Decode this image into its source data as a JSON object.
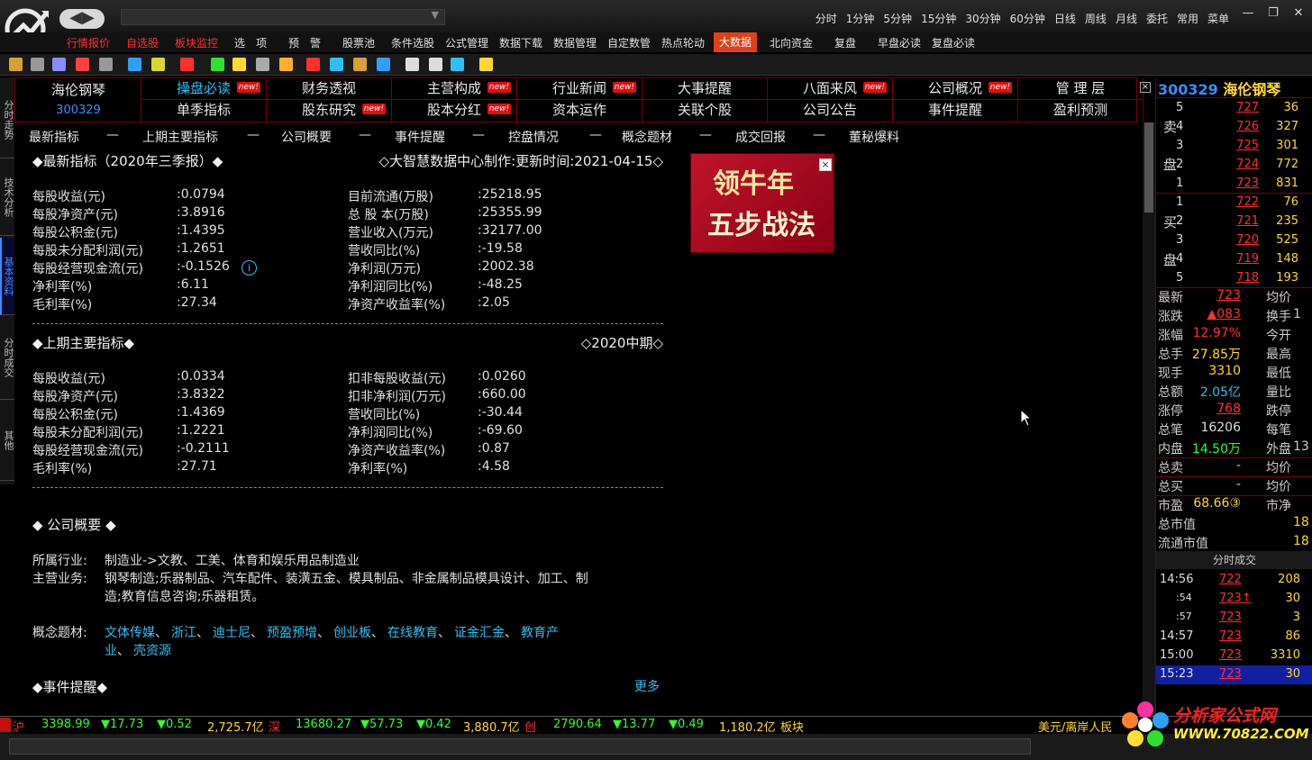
{
  "titlebar": {
    "back_label": "◀▶",
    "periods": [
      "分时",
      "1分钟",
      "5分钟",
      "15分钟",
      "30分钟",
      "60分钟",
      "日线",
      "周线",
      "月线",
      "委托",
      "常用",
      "菜单"
    ]
  },
  "menu": [
    {
      "label": "行情报价",
      "style": "red"
    },
    {
      "label": "自选股",
      "style": "red"
    },
    {
      "label": "板块监控",
      "style": "red"
    },
    {
      "label": "选　项",
      "style": ""
    },
    {
      "label": "预　警",
      "style": ""
    },
    {
      "label": "股票池",
      "style": ""
    },
    {
      "label": "条件选股",
      "style": ""
    },
    {
      "label": "公式管理",
      "style": ""
    },
    {
      "label": "数据下载",
      "style": ""
    },
    {
      "label": "数据管理",
      "style": ""
    },
    {
      "label": "自定数管",
      "style": ""
    },
    {
      "label": "热点轮动",
      "style": ""
    },
    {
      "label": "大数据",
      "style": "active"
    },
    {
      "label": "北向资金",
      "style": ""
    },
    {
      "label": "复盘",
      "style": ""
    },
    {
      "label": "早盘必读",
      "style": ""
    },
    {
      "label": "复盘必读",
      "style": ""
    }
  ],
  "left_tabs": [
    "分时走势",
    "技术分析",
    "基本资料",
    "分时成交",
    "其他"
  ],
  "stock": {
    "name": "海伦钢琴",
    "code": "300329"
  },
  "function_grid": {
    "row1": [
      {
        "label": "操盘必读",
        "new": true,
        "color": "#30c0f0"
      },
      {
        "label": "财务透视",
        "new": false
      },
      {
        "label": "主营构成",
        "new": true
      },
      {
        "label": "行业新闻",
        "new": true
      },
      {
        "label": "大事提醒",
        "new": false
      },
      {
        "label": "八面来风",
        "new": true
      },
      {
        "label": "公司概况",
        "new": true
      },
      {
        "label": "管 理 层",
        "new": false
      }
    ],
    "row2": [
      {
        "label": "单季指标",
        "new": false
      },
      {
        "label": "股东研究",
        "new": true
      },
      {
        "label": "股本分红",
        "new": true
      },
      {
        "label": "资本运作",
        "new": false
      },
      {
        "label": "关联个股",
        "new": false
      },
      {
        "label": "公司公告",
        "new": false
      },
      {
        "label": "事件提醒",
        "new": false
      },
      {
        "label": "盈利预测",
        "new": false
      }
    ],
    "new_badge": "new!",
    "close": "×"
  },
  "subtabs": [
    "最新指标",
    "—",
    "上期主要指标",
    "—",
    "公司概要",
    "—",
    "事件提醒",
    "—",
    "控盘情况",
    "—",
    "概念题材",
    "—",
    "成交回报",
    "—",
    "董秘爆料"
  ],
  "section1": {
    "title": "◆最新指标（2020年三季报）◆",
    "source": "◇大智慧数据中心制作:更新时间:2021-04-15◇",
    "left": [
      {
        "k": "每股收益(元)",
        "v": ":0.0794"
      },
      {
        "k": "每股净资产(元)",
        "v": ":3.8916"
      },
      {
        "k": "每股公积金(元)",
        "v": ":1.4395"
      },
      {
        "k": "每股未分配利润(元)",
        "v": ":1.2651"
      },
      {
        "k": "每股经营现金流(元)",
        "v": ":-0.1526"
      },
      {
        "k": "净利率(%)",
        "v": ":6.11"
      },
      {
        "k": "毛利率(%)",
        "v": ":27.34"
      }
    ],
    "right": [
      {
        "k": "目前流通(万股)",
        "v": ":25218.95"
      },
      {
        "k": "总 股 本(万股)",
        "v": ":25355.99"
      },
      {
        "k": "营业收入(万元)",
        "v": ":32177.00"
      },
      {
        "k": "营收同比(%)",
        "v": ":-19.58"
      },
      {
        "k": "净利润(万元)",
        "v": ":2002.38"
      },
      {
        "k": "净利润同比(%)",
        "v": ":-48.25"
      },
      {
        "k": "净资产收益率(%)",
        "v": ":2.05"
      }
    ],
    "info_icon": "i"
  },
  "section2": {
    "title": "◆上期主要指标◆",
    "period": "◇2020中期◇",
    "left": [
      {
        "k": "每股收益(元)",
        "v": ":0.0334"
      },
      {
        "k": "每股净资产(元)",
        "v": ":3.8322"
      },
      {
        "k": "每股公积金(元)",
        "v": ":1.4369"
      },
      {
        "k": "每股未分配利润(元)",
        "v": ":1.2221"
      },
      {
        "k": "每股经营现金流(元)",
        "v": ":-0.2111"
      },
      {
        "k": "毛利率(%)",
        "v": ":27.71"
      }
    ],
    "right": [
      {
        "k": "扣非每股收益(元)",
        "v": ":0.0260"
      },
      {
        "k": "扣非净利润(万元)",
        "v": ":660.00"
      },
      {
        "k": "营收同比(%)",
        "v": ":-30.44"
      },
      {
        "k": "净利润同比(%)",
        "v": ":-69.60"
      },
      {
        "k": "净资产收益率(%)",
        "v": ":0.87"
      },
      {
        "k": "净利率(%)",
        "v": ":4.58"
      }
    ]
  },
  "section3": {
    "title": "◆ 公司概要 ◆",
    "industry_label": "所属行业:",
    "industry": "制造业->文教、工美、体育和娱乐用品制造业",
    "business_label": "主营业务:",
    "business_line1": "钢琴制造;乐器制品、汽车配件、装潢五金、模具制品、非金属制品模具设计、加工、制",
    "business_line2": "造;教育信息咨询;乐器租赁。",
    "concept_label": "概念题材:",
    "concepts_line1": [
      "文体传媒",
      "浙江",
      "迪士尼",
      "预盈预增",
      "创业板",
      "在线教育",
      "证金汇金",
      "教育产"
    ],
    "concepts_line2": [
      "业",
      "壳资源"
    ],
    "sep": "、"
  },
  "section4": {
    "title": "◆事件提醒◆",
    "more": "更多"
  },
  "ad": {
    "line1": "领牛年",
    "line2": "五步战法",
    "close": "×"
  },
  "right_panel": {
    "name": "海伦钢琴",
    "code": "300329",
    "sell_label": [
      "卖",
      "盘"
    ],
    "buy_label": [
      "买",
      "盘"
    ],
    "sell": [
      {
        "lv": "5",
        "p": "727",
        "v": "36"
      },
      {
        "lv": "4",
        "p": "726",
        "v": "327"
      },
      {
        "lv": "3",
        "p": "725",
        "v": "301"
      },
      {
        "lv": "2",
        "p": "724",
        "v": "772"
      },
      {
        "lv": "1",
        "p": "723",
        "v": "831"
      }
    ],
    "buy": [
      {
        "lv": "1",
        "p": "722",
        "v": "76"
      },
      {
        "lv": "2",
        "p": "721",
        "v": "235"
      },
      {
        "lv": "3",
        "p": "720",
        "v": "525"
      },
      {
        "lv": "4",
        "p": "719",
        "v": "148"
      },
      {
        "lv": "5",
        "p": "718",
        "v": "193"
      }
    ],
    "quote": [
      {
        "k": "最新",
        "v": "723",
        "c": "#ff3030",
        "u": true,
        "k2": "均价",
        "v2": ""
      },
      {
        "k": "涨跌",
        "v": "▲083",
        "c": "#ff3030",
        "u": true,
        "k2": "换手",
        "v2": "1"
      },
      {
        "k": "涨幅",
        "v": "12.97%",
        "c": "#ff3030",
        "u": false,
        "k2": "今开",
        "v2": ""
      },
      {
        "k": "总手",
        "v": "27.85万",
        "c": "#ffd830",
        "u": false,
        "k2": "最高",
        "v2": ""
      },
      {
        "k": "现手",
        "v": "3310",
        "c": "#ffd830",
        "u": false,
        "k2": "最低",
        "v2": ""
      },
      {
        "k": "总额",
        "v": "2.05亿",
        "c": "#30c0f0",
        "u": false,
        "k2": "量比",
        "v2": ""
      },
      {
        "k": "涨停",
        "v": "768",
        "c": "#ff3030",
        "u": true,
        "k2": "跌停",
        "v2": ""
      },
      {
        "k": "总笔",
        "v": "16206",
        "c": "#ddd",
        "u": false,
        "k2": "每笔",
        "v2": ""
      },
      {
        "k": "内盘",
        "v": "14.50万",
        "c": "#30ff30",
        "u": false,
        "k2": "外盘",
        "v2": "13"
      }
    ],
    "totals": [
      {
        "k": "总卖",
        "v": "-",
        "k2": "均价"
      },
      {
        "k": "总买",
        "v": "-",
        "k2": "均价"
      }
    ],
    "valuation": [
      {
        "k": "市盈",
        "v": "68.66③",
        "k2": "市净",
        "v2": ""
      },
      {
        "k": "总市值",
        "v": "",
        "k2": "",
        "v2": "18"
      },
      {
        "k": "流通市值",
        "v": "",
        "k2": "",
        "v2": "18"
      }
    ],
    "ticks_header": "分时成交",
    "ticks": [
      {
        "t": "14:56",
        "p": "722",
        "q": "208",
        "sel": false
      },
      {
        "t": ":54",
        "p": "723↑",
        "q": "30",
        "sel": false
      },
      {
        "t": ":57",
        "p": "723",
        "q": "3",
        "sel": false
      },
      {
        "t": "14:57",
        "p": "723",
        "q": "86",
        "sel": false
      },
      {
        "t": "15:00",
        "p": "723",
        "q": "3310",
        "sel": false
      },
      {
        "t": "15:23",
        "p": "723",
        "q": "30",
        "sel": true
      }
    ]
  },
  "bottom_bar": {
    "sh": {
      "label": "沪",
      "idx": "3398.99",
      "chg": "▼17.73",
      "pct": "▼0.52",
      "amt": "2,725.7亿"
    },
    "sz": {
      "label": "深",
      "idx": "13680.27",
      "chg": "▼57.73",
      "pct": "▼0.42",
      "amt": "3,880.7亿"
    },
    "cy": {
      "label": "创",
      "idx": "2790.64",
      "chg": "▼13.77",
      "pct": "▼0.49",
      "amt": "1,180.2亿"
    },
    "board": "板块",
    "fx": "美元/离岸人民"
  },
  "watermark": {
    "line1": "分析家公式网",
    "line2": "WWW.70822.COM"
  }
}
